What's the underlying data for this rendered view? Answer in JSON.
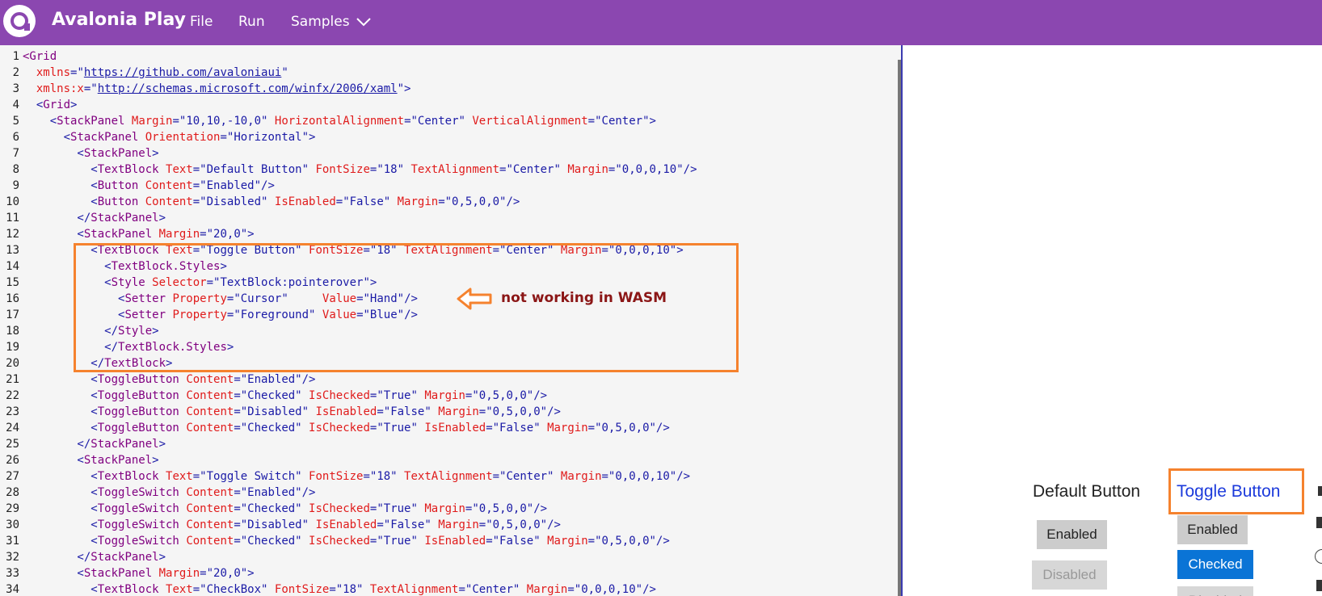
{
  "app": {
    "title": "Avalonia Play"
  },
  "menu": {
    "file": "File",
    "run": "Run",
    "samples": "Samples"
  },
  "editor": {
    "line_numbers": [
      "1",
      "2",
      "3",
      "4",
      "5",
      "6",
      "7",
      "8",
      "9",
      "10",
      "11",
      "12",
      "13",
      "14",
      "15",
      "16",
      "17",
      "18",
      "19",
      "20",
      "21",
      "22",
      "23",
      "24",
      "25",
      "26",
      "27",
      "28",
      "29",
      "30",
      "31",
      "32",
      "33",
      "34"
    ],
    "lines": [
      [
        "<Grid"
      ],
      [
        "  ",
        "xmlns",
        "=\"",
        "https://github.com/avaloniaui",
        "\""
      ],
      [
        "  ",
        "xmlns:x",
        "=\"",
        "http://schemas.microsoft.com/winfx/2006/xaml",
        "\">"
      ],
      [
        "  <",
        "Grid",
        ">"
      ],
      [
        "    <",
        "StackPanel",
        " ",
        "Margin",
        "=\"10,10,-10,0\" ",
        "HorizontalAlignment",
        "=\"Center\" ",
        "VerticalAlignment",
        "=\"Center\">"
      ],
      [
        "      <",
        "StackPanel",
        " ",
        "Orientation",
        "=\"Horizontal\">"
      ],
      [
        "        <",
        "StackPanel",
        ">"
      ],
      [
        "          <",
        "TextBlock",
        " ",
        "Text",
        "=\"Default Button\" ",
        "FontSize",
        "=\"18\" ",
        "TextAlignment",
        "=\"Center\" ",
        "Margin",
        "=\"0,0,0,10\"/>"
      ],
      [
        "          <",
        "Button",
        " ",
        "Content",
        "=\"Enabled\"/>"
      ],
      [
        "          <",
        "Button",
        " ",
        "Content",
        "=\"Disabled\" ",
        "IsEnabled",
        "=\"False\" ",
        "Margin",
        "=\"0,5,0,0\"/>"
      ],
      [
        "        </",
        "StackPanel",
        ">"
      ],
      [
        "        <",
        "StackPanel",
        " ",
        "Margin",
        "=\"20,0\">"
      ],
      [
        "          <",
        "TextBlock",
        " ",
        "Text",
        "=\"Toggle Button\" ",
        "FontSize",
        "=\"18\" ",
        "TextAlignment",
        "=\"Center\" ",
        "Margin",
        "=\"0,0,0,10\">"
      ],
      [
        "            <",
        "TextBlock.Styles",
        ">"
      ],
      [
        "            <",
        "Style",
        " ",
        "Selector",
        "=\"TextBlock:pointerover\">"
      ],
      [
        "              <",
        "Setter",
        " ",
        "Property",
        "=\"Cursor\"     ",
        "Value",
        "=\"Hand\"/>"
      ],
      [
        "              <",
        "Setter",
        " ",
        "Property",
        "=\"Foreground\" ",
        "Value",
        "=\"Blue\"/>"
      ],
      [
        "            </",
        "Style",
        ">"
      ],
      [
        "            </",
        "TextBlock.Styles",
        ">"
      ],
      [
        "          </",
        "TextBlock",
        ">"
      ],
      [
        "          <",
        "ToggleButton",
        " ",
        "Content",
        "=\"Enabled\"/>"
      ],
      [
        "          <",
        "ToggleButton",
        " ",
        "Content",
        "=\"Checked\" ",
        "IsChecked",
        "=\"True\" ",
        "Margin",
        "=\"0,5,0,0\"/>"
      ],
      [
        "          <",
        "ToggleButton",
        " ",
        "Content",
        "=\"Disabled\" ",
        "IsEnabled",
        "=\"False\" ",
        "Margin",
        "=\"0,5,0,0\"/>"
      ],
      [
        "          <",
        "ToggleButton",
        " ",
        "Content",
        "=\"Checked\" ",
        "IsChecked",
        "=\"True\" ",
        "IsEnabled",
        "=\"False\" ",
        "Margin",
        "=\"0,5,0,0\"/>"
      ],
      [
        "        </",
        "StackPanel",
        ">"
      ],
      [
        "        <",
        "StackPanel",
        ">"
      ],
      [
        "          <",
        "TextBlock",
        " ",
        "Text",
        "=\"Toggle Switch\" ",
        "FontSize",
        "=\"18\" ",
        "TextAlignment",
        "=\"Center\" ",
        "Margin",
        "=\"0,0,0,10\"/>"
      ],
      [
        "          <",
        "ToggleSwitch",
        " ",
        "Content",
        "=\"Enabled\"/>"
      ],
      [
        "          <",
        "ToggleSwitch",
        " ",
        "Content",
        "=\"Checked\" ",
        "IsChecked",
        "=\"True\" ",
        "Margin",
        "=\"0,5,0,0\"/>"
      ],
      [
        "          <",
        "ToggleSwitch",
        " ",
        "Content",
        "=\"Disabled\" ",
        "IsEnabled",
        "=\"False\" ",
        "Margin",
        "=\"0,5,0,0\"/>"
      ],
      [
        "          <",
        "ToggleSwitch",
        " ",
        "Content",
        "=\"Checked\" ",
        "IsChecked",
        "=\"True\" ",
        "IsEnabled",
        "=\"False\" ",
        "Margin",
        "=\"0,5,0,0\"/>"
      ],
      [
        "        </",
        "StackPanel",
        ">"
      ],
      [
        "        <",
        "StackPanel",
        " ",
        "Margin",
        "=\"20,0\">"
      ],
      [
        "          <",
        "TextBlock",
        " ",
        "Text",
        "=\"CheckBox\" ",
        "FontSize",
        "=\"18\" ",
        "TextAlignment",
        "=\"Center\" ",
        "Margin",
        "=\"0,0,0,10\"/>"
      ]
    ]
  },
  "annotation": {
    "text": "not working in WASM"
  },
  "preview": {
    "default_heading": "Default Button",
    "toggle_heading": "Toggle Button",
    "enabled_button": "Enabled",
    "disabled_button": "Disabled",
    "toggle_enabled": "Enabled",
    "toggle_checked": "Checked",
    "toggle_disabled": "Disabled"
  },
  "colors": {
    "topbar": "#8b47b0",
    "editor_bg": "#f5f5f5",
    "highlight": "#f5822e",
    "note": "#8b1616",
    "checked": "#0a74d6",
    "link_blue": "#1a1aa6"
  }
}
